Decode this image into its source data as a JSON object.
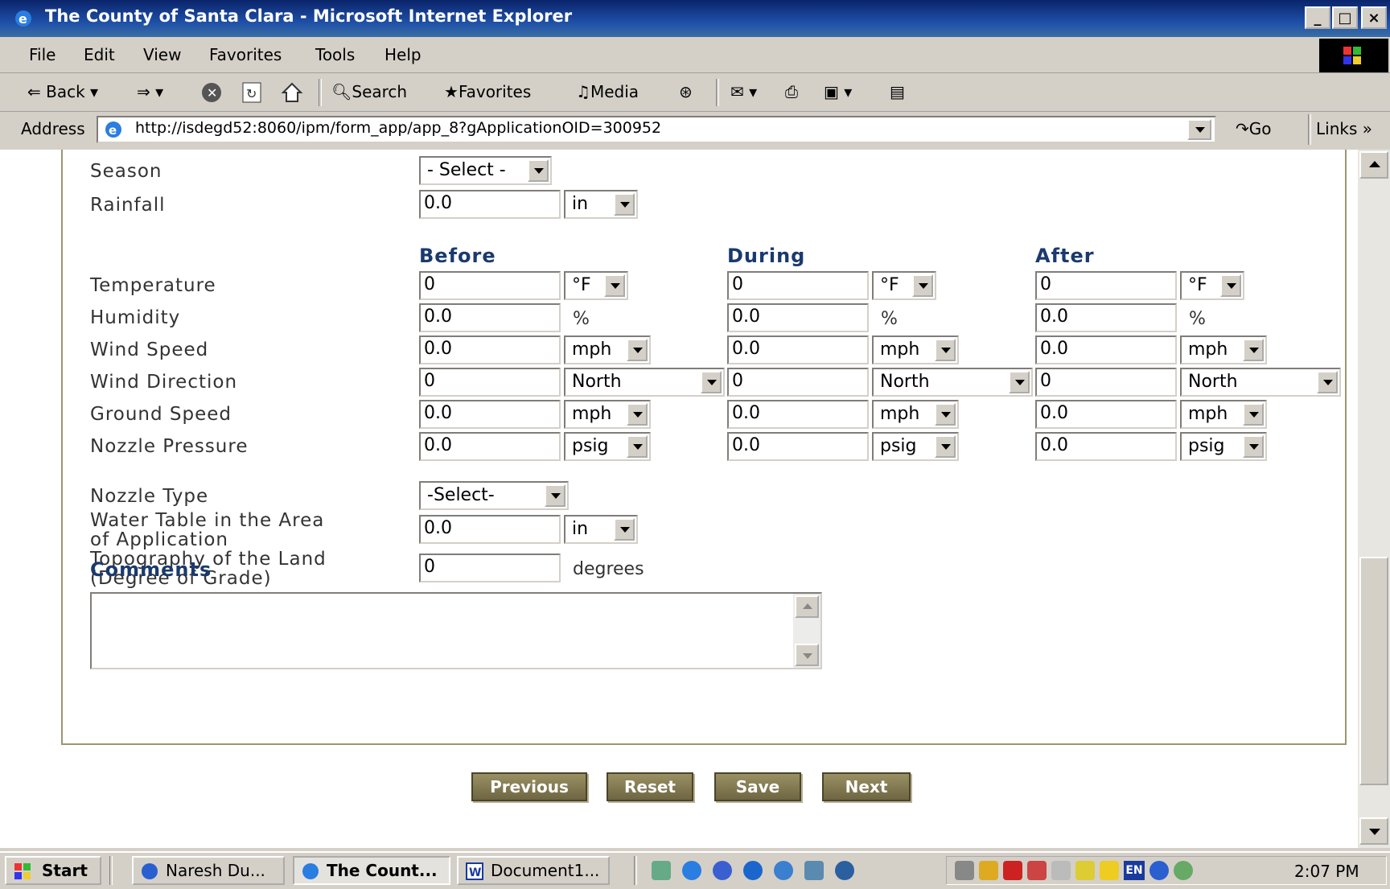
{
  "window": {
    "title": "The County of Santa Clara - Microsoft Internet Explorer"
  },
  "menu": [
    "File",
    "Edit",
    "View",
    "Favorites",
    "Tools",
    "Help"
  ],
  "toolbar": {
    "back": "Back",
    "search": "Search",
    "favorites": "Favorites",
    "media": "Media"
  },
  "address": {
    "label": "Address",
    "url": "http://isdegd52:8060/ipm/form_app/app_8?gApplicationOID=300952",
    "go": "Go",
    "links": "Links"
  },
  "form": {
    "season": {
      "label": "Season",
      "value": "- Select -"
    },
    "rainfall": {
      "label": "Rainfall",
      "value": "0.0",
      "unit": "in"
    },
    "columns": [
      "Before",
      "During",
      "After"
    ],
    "temperature": {
      "label": "Temperature",
      "values": [
        "0",
        "0",
        "0"
      ],
      "unit": "°F"
    },
    "humidity": {
      "label": "Humidity",
      "values": [
        "0.0",
        "0.0",
        "0.0"
      ],
      "unit": "%"
    },
    "wind_speed": {
      "label": "Wind Speed",
      "values": [
        "0.0",
        "0.0",
        "0.0"
      ],
      "unit": "mph"
    },
    "wind_direction": {
      "label": "Wind Direction",
      "values": [
        "0",
        "0",
        "0"
      ],
      "unit": "North"
    },
    "ground_speed": {
      "label": "Ground Speed",
      "values": [
        "0.0",
        "0.0",
        "0.0"
      ],
      "unit": "mph"
    },
    "nozzle_pressure": {
      "label": "Nozzle Pressure",
      "values": [
        "0.0",
        "0.0",
        "0.0"
      ],
      "unit": "psig"
    },
    "nozzle_type": {
      "label": "Nozzle Type",
      "value": "-Select-"
    },
    "water_table": {
      "label_line1": "Water Table in the Area",
      "label_line2": "of Application",
      "value": "0.0",
      "unit": "in"
    },
    "topography": {
      "label_line1": "Topography of the Land",
      "label_line2": "(Degree of Grade)",
      "value": "0",
      "unit": "degrees"
    },
    "comments": {
      "label": "Comments",
      "value": ""
    }
  },
  "buttons": {
    "previous": "Previous",
    "reset": "Reset",
    "save": "Save",
    "next": "Next"
  },
  "taskbar": {
    "start": "Start",
    "tasks": [
      "Naresh Du...",
      "The Count...",
      "Document1..."
    ],
    "clock": "2:07 PM",
    "lang": "EN"
  }
}
